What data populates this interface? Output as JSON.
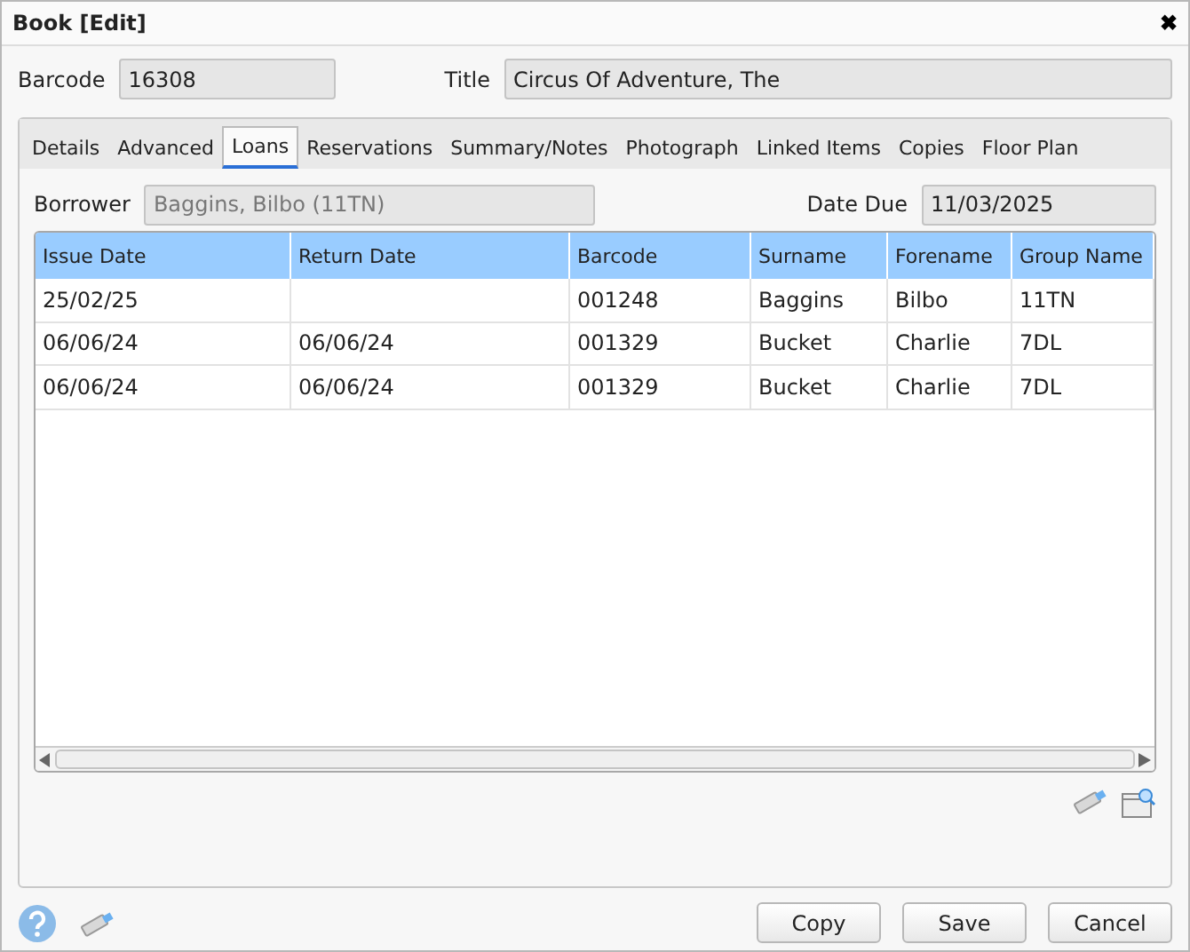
{
  "window": {
    "title": "Book [Edit]",
    "close": "✖"
  },
  "fields": [
    {
      "label": "Barcode",
      "value": "16308"
    },
    {
      "label": "Title",
      "value": "Circus Of Adventure, The"
    }
  ],
  "tabs": [
    {
      "label": "Details",
      "selected": false
    },
    {
      "label": "Advanced",
      "selected": false
    },
    {
      "label": "Loans",
      "selected": true
    },
    {
      "label": "Reservations",
      "selected": false
    },
    {
      "label": "Summary/Notes",
      "selected": false
    },
    {
      "label": "Photograph",
      "selected": false
    },
    {
      "label": "Linked Items",
      "selected": false
    },
    {
      "label": "Copies",
      "selected": false
    },
    {
      "label": "Floor Plan",
      "selected": false
    }
  ],
  "loans": {
    "borrower": {
      "label": "Borrower",
      "value": "Baggins, Bilbo (11TN)"
    },
    "date_due": {
      "label": "Date Due",
      "value": "11/03/2025"
    },
    "table": {
      "columns": [
        "Issue Date",
        "Return Date",
        "Barcode",
        "Surname",
        "Forename",
        "Group Name"
      ],
      "rows": [
        [
          "25/02/25",
          "",
          "001248",
          "Baggins",
          "Bilbo",
          "11TN"
        ],
        [
          "06/06/24",
          "06/06/24",
          "001329",
          "Bucket",
          "Charlie",
          "7DL"
        ],
        [
          "06/06/24",
          "06/06/24",
          "001329",
          "Bucket",
          "Charlie",
          "7DL"
        ]
      ]
    }
  },
  "buttons": [
    "Copy",
    "Save",
    "Cancel"
  ]
}
